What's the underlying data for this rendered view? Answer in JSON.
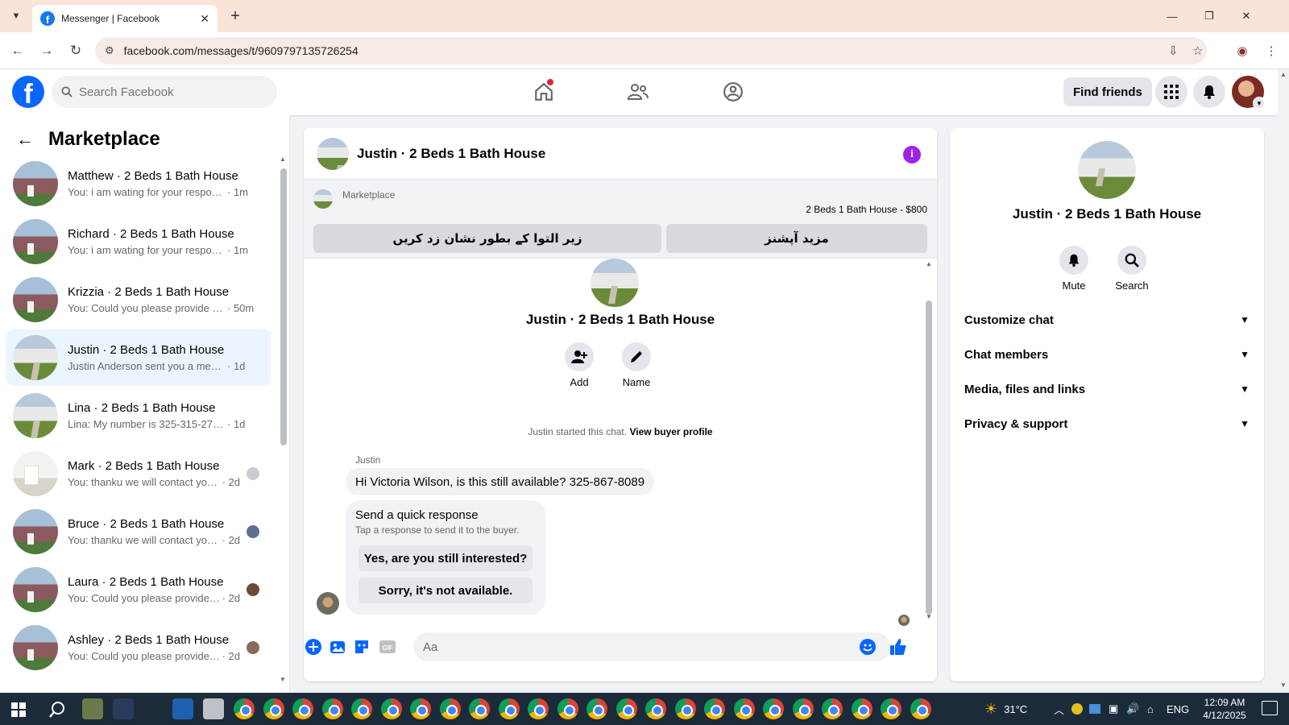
{
  "browser": {
    "tab_title": "Messenger | Facebook",
    "url": "facebook.com/messages/t/9609797135726254"
  },
  "fb_header": {
    "search_placeholder": "Search Facebook",
    "find_friends_label": "Find friends"
  },
  "sidebar": {
    "title": "Marketplace",
    "conversations": [
      {
        "name": "Matthew · 2 Beds 1 Bath House",
        "preview": "You: i am wating for your response",
        "time": "· 1m",
        "avatar": "house"
      },
      {
        "name": "Richard · 2 Beds 1 Bath House",
        "preview": "You: i am wating for your response",
        "time": "· 1m",
        "avatar": "house"
      },
      {
        "name": "Krizzia · 2 Beds 1 Bath House",
        "preview": "You: Could you please provide m...",
        "time": "· 50m",
        "avatar": "house"
      },
      {
        "name": "Justin · 2 Beds 1 Bath House",
        "preview": "Justin Anderson sent you a messag...",
        "time": "· 1d",
        "avatar": "white",
        "active": true
      },
      {
        "name": "Lina · 2 Beds 1 Bath House",
        "preview": "Lina: My number is 325-315-2705 L...",
        "time": "· 1d",
        "avatar": "white"
      },
      {
        "name": "Mark · 2 Beds 1 Bath House",
        "preview": "You: thanku we will contact you ...",
        "time": "· 2d",
        "avatar": "room",
        "seen": "#c9ccd1"
      },
      {
        "name": "Bruce · 2 Beds 1 Bath House",
        "preview": "You: thanku we will contact you ...",
        "time": "· 2d",
        "avatar": "house",
        "seen": "#5a6f8f"
      },
      {
        "name": "Laura · 2 Beds 1 Bath House",
        "preview": "You: Could you please provide ...",
        "time": "· 2d",
        "avatar": "house",
        "seen": "#6b4a3a"
      },
      {
        "name": "Ashley · 2 Beds 1 Bath House",
        "preview": "You: Could you please provide ...",
        "time": "· 2d",
        "avatar": "house",
        "seen": "#8a6a5a"
      }
    ]
  },
  "chat": {
    "title": "Justin · 2 Beds 1 Bath House",
    "marketplace_label": "Marketplace",
    "listing": "2 Beds 1 Bath House - $800",
    "mark_pending_btn": "زیر التوا کے بطور نشان زد کریں",
    "more_options_btn": "مزید آپشنز",
    "profile_name": "Justin · 2 Beds 1 Bath House",
    "add_label": "Add",
    "name_label": "Name",
    "started_text": "Justin started this chat.",
    "view_buyer_profile": "View buyer profile",
    "sender": "Justin",
    "message": "Hi Victoria Wilson, is this still available? 325-867-8089",
    "quick_title": "Send a quick response",
    "quick_sub": "Tap a response to send it to the buyer.",
    "quick_reply_1": "Yes, are you still interested?",
    "quick_reply_2": "Sorry, it's not available.",
    "composer_placeholder": "Aa"
  },
  "right_panel": {
    "name": "Justin · 2 Beds 1 Bath House",
    "mute_label": "Mute",
    "search_label": "Search",
    "sections": [
      "Customize chat",
      "Chat members",
      "Media, files and links",
      "Privacy & support"
    ]
  },
  "taskbar": {
    "temperature": "31°C",
    "language": "ENG",
    "time": "12:09 AM",
    "date": "4/12/2025"
  },
  "colors": {
    "fb_blue": "#0866ff",
    "accent_purple": "#a020f0",
    "tabbar_bg": "#fbe3d8"
  }
}
